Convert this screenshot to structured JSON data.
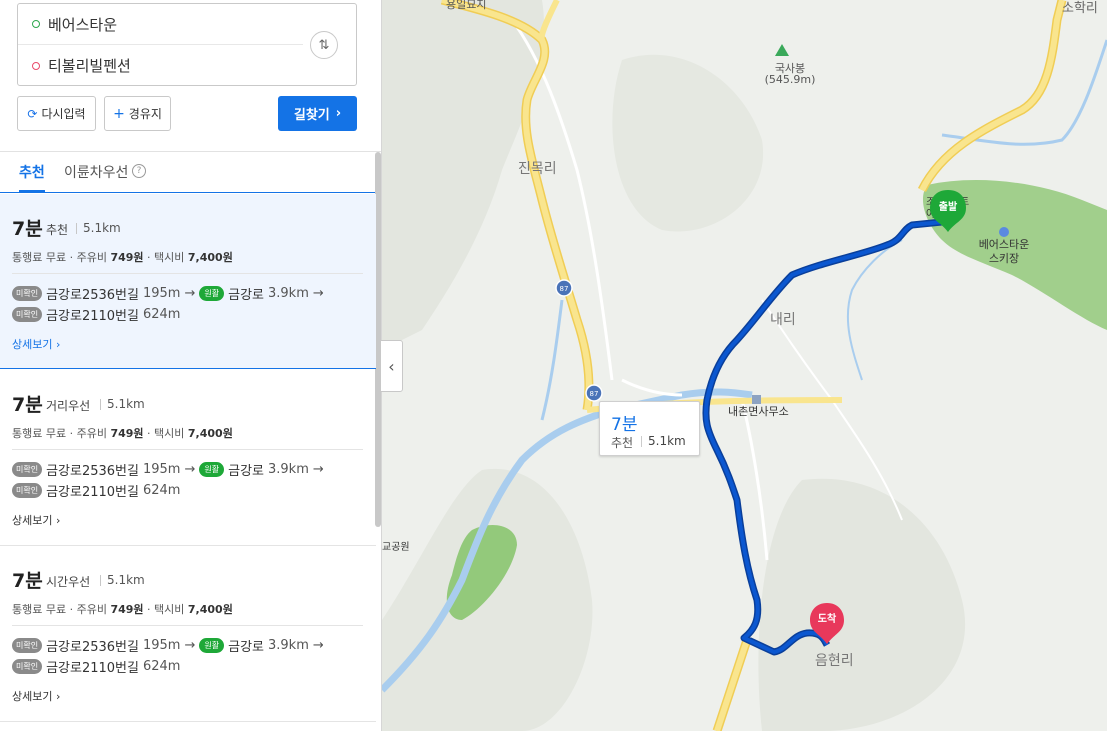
{
  "route_form": {
    "start": "베어스타운",
    "end": "티볼리빌펜션",
    "reset_label": "다시입력",
    "waypoint_label": "경유지",
    "search_label": "길찾기"
  },
  "tabs": {
    "recommended": "추천",
    "two_wheeler": "이륜차우선"
  },
  "routes": [
    {
      "time": "7분",
      "type": "추천",
      "distance": "5.1km",
      "fare_prefix": "통행료 무료 · 주유비 ",
      "fuel": "749원",
      "taxi_prefix": " · 택시비 ",
      "taxi": "7,400원",
      "badge_unverified": "미확인",
      "road1": "금강로2536번길",
      "road1_len": "195m",
      "badge_smooth": "원활",
      "road2": "금강로",
      "road2_len": "3.9km",
      "road3": "금강로2110번길",
      "road3_len": "624m",
      "detail": "상세보기"
    },
    {
      "time": "7분",
      "type": "거리우선",
      "distance": "5.1km",
      "fare_prefix": "통행료 무료 · 주유비 ",
      "fuel": "749원",
      "taxi_prefix": " · 택시비 ",
      "taxi": "7,400원",
      "badge_unverified": "미확인",
      "road1": "금강로2536번길",
      "road1_len": "195m",
      "badge_smooth": "원활",
      "road2": "금강로",
      "road2_len": "3.9km",
      "road3": "금강로2110번길",
      "road3_len": "624m",
      "detail": "상세보기"
    },
    {
      "time": "7분",
      "type": "시간우선",
      "distance": "5.1km",
      "fare_prefix": "통행료 무료 · 주유비 ",
      "fuel": "749원",
      "taxi_prefix": " · 택시비 ",
      "taxi": "7,400원",
      "badge_unverified": "미확인",
      "road1": "금강로2536번길",
      "road1_len": "195m",
      "badge_smooth": "원활",
      "road2": "금강로",
      "road2_len": "3.9km",
      "road3": "금강로2110번길",
      "road3_len": "624m",
      "detail": "상세보기"
    }
  ],
  "map": {
    "labels": {
      "top_cut": "용일묘지",
      "top_right": "소학리",
      "peak_name": "국사봉",
      "peak_height": "(545.9m)",
      "jinmok": "진목리",
      "naeri": "내리",
      "office": "내촌면사무소",
      "ski_line1": "베어스타운",
      "ski_line2": "스키장",
      "park_cut": "교공원",
      "eumhyeon": "음현리",
      "start_label_cut1": "조",
      "start_label_cut2": "아",
      "start_label_cut3": "트",
      "route_87": "87"
    },
    "pins": {
      "start": "출발",
      "end": "도착"
    },
    "tooltip": {
      "time": "7분",
      "type": "추천",
      "distance": "5.1km"
    },
    "colors": {
      "route": "#0b57d0",
      "route_outline": "#0a3f9a",
      "start_pin": "#1ea838",
      "end_pin": "#e8385b",
      "river": "#a9cdee",
      "park": "#93c97b",
      "road_major": "#f5dd80"
    }
  }
}
